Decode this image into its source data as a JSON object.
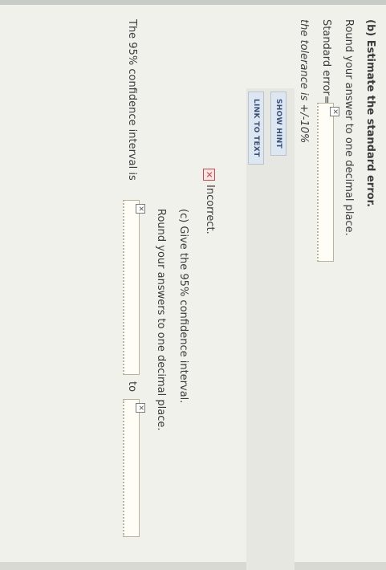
{
  "part_b": {
    "heading": "(b) Estimate the standard error.",
    "instruction": "Round your answer to one decimal place.",
    "field_label": "Standard error=",
    "tolerance": "the tolerance is +/-10%"
  },
  "hint_panel": {
    "show_hint": "SHOW HINT",
    "link_to_text": "LINK TO TEXT"
  },
  "feedback": {
    "status": "Incorrect."
  },
  "part_c": {
    "heading": "(c) Give the 95% confidence interval.",
    "instruction": "Round your answers to one decimal place.",
    "interval_label": "The 95% confidence interval is",
    "to_label": "to"
  },
  "icons": {
    "field_status": "x-mark",
    "feedback": "x-mark"
  },
  "colors": {
    "error": "#c94b4b",
    "link_text": "#3b4f78"
  }
}
